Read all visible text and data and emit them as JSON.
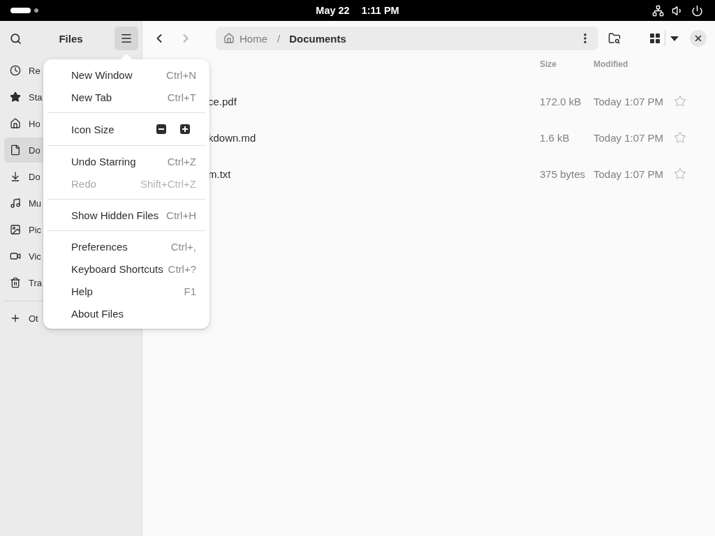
{
  "top_bar": {
    "date": "May 22",
    "time": "1:11 PM"
  },
  "sidebar": {
    "title": "Files",
    "menu_button": {
      "expanded": true
    },
    "items": [
      {
        "kind": "recent",
        "label": "Re",
        "selected": false
      },
      {
        "kind": "starred",
        "label": "Sta",
        "selected": false
      },
      {
        "kind": "home",
        "label": "Ho",
        "selected": false
      },
      {
        "kind": "documents",
        "label": "Do",
        "selected": true
      },
      {
        "kind": "downloads",
        "label": "Do",
        "selected": false
      },
      {
        "kind": "music",
        "label": "Mu",
        "selected": false
      },
      {
        "kind": "pictures",
        "label": "Pic",
        "selected": false
      },
      {
        "kind": "videos",
        "label": "Vic",
        "selected": false
      },
      {
        "kind": "trash",
        "label": "Tra",
        "selected": false
      }
    ],
    "other_locations": {
      "label": "Ot"
    }
  },
  "toolbar": {
    "nav_buttons": [
      {
        "kind": "back",
        "disabled": false
      },
      {
        "kind": "forward",
        "disabled": true
      }
    ],
    "path": {
      "separator": "/",
      "segments": [
        {
          "kind": "home",
          "label": "Home",
          "selected": false
        },
        {
          "kind": "folder",
          "label": "Documents",
          "selected": true
        }
      ]
    }
  },
  "files": {
    "columns": [
      {
        "label": "Size"
      },
      {
        "label": "Modified"
      }
    ],
    "rows": [
      {
        "name": "ce.pdf",
        "size": "172.0 kB",
        "modified": "Today 1:07 PM",
        "starred": false
      },
      {
        "name": "kdown.md",
        "size": "1.6 kB",
        "modified": "Today 1:07 PM",
        "starred": false
      },
      {
        "name": "m.txt",
        "size": "375 bytes",
        "modified": "Today 1:07 PM",
        "starred": false
      }
    ]
  },
  "menu": {
    "sections": [
      {
        "items": [
          {
            "kind": "action",
            "label": "New Window",
            "shortcut": "Ctrl+N",
            "disabled": false
          },
          {
            "kind": "action",
            "label": "New Tab",
            "shortcut": "Ctrl+T",
            "disabled": false
          }
        ]
      },
      {
        "items": [
          {
            "kind": "icon_size",
            "label": "Icon Size",
            "disabled": false
          }
        ]
      },
      {
        "items": [
          {
            "kind": "action",
            "label": "Undo Starring",
            "shortcut": "Ctrl+Z",
            "disabled": false
          },
          {
            "kind": "action",
            "label": "Redo",
            "shortcut": "Shift+Ctrl+Z",
            "disabled": true
          }
        ]
      },
      {
        "items": [
          {
            "kind": "action",
            "label": "Show Hidden Files",
            "shortcut": "Ctrl+H",
            "disabled": false
          }
        ]
      },
      {
        "items": [
          {
            "kind": "action",
            "label": "Preferences",
            "shortcut": "Ctrl+,",
            "disabled": false
          },
          {
            "kind": "action",
            "label": "Keyboard Shortcuts",
            "shortcut": "Ctrl+?",
            "disabled": false
          },
          {
            "kind": "action",
            "label": "Help",
            "shortcut": "F1",
            "disabled": false
          },
          {
            "kind": "action",
            "label": "About Files",
            "disabled": false
          }
        ]
      }
    ]
  }
}
